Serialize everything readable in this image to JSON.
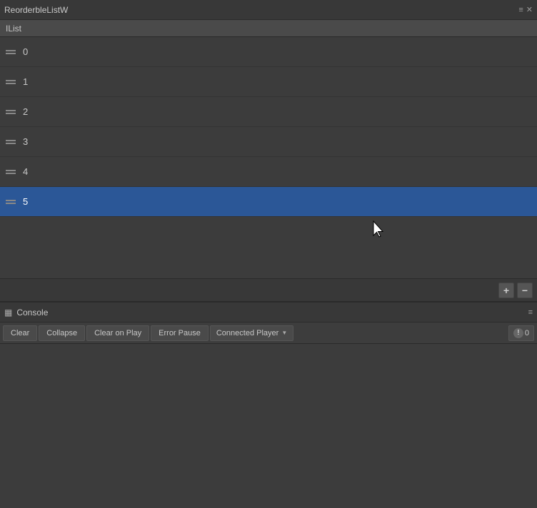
{
  "titleBar": {
    "title": "ReorderbleListW",
    "controls": {
      "menuIcon": "≡",
      "closeIcon": "✕"
    }
  },
  "listPanel": {
    "header": "IList",
    "items": [
      {
        "id": 0,
        "label": "0",
        "selected": false
      },
      {
        "id": 1,
        "label": "1",
        "selected": false
      },
      {
        "id": 2,
        "label": "2",
        "selected": false
      },
      {
        "id": 3,
        "label": "3",
        "selected": false
      },
      {
        "id": 4,
        "label": "4",
        "selected": false
      },
      {
        "id": 5,
        "label": "5",
        "selected": true
      }
    ],
    "addButton": "+",
    "removeButton": "−"
  },
  "consolePanel": {
    "title": "Console",
    "icon": "▦",
    "menuIcon": "≡",
    "toolbar": {
      "clearButton": "Clear",
      "collapseButton": "Collapse",
      "clearOnPlayButton": "Clear on Play",
      "errorPauseButton": "Error Pause",
      "connectedPlayerButton": "Connected Player",
      "dropdownArrow": "▼",
      "badgeCount": "0"
    }
  },
  "colors": {
    "selectedRow": "#2b5797",
    "background": "#3c3c3c",
    "headerBg": "#4a4a4a",
    "titleBg": "#383838",
    "buttonBg": "#4a4a4a"
  }
}
